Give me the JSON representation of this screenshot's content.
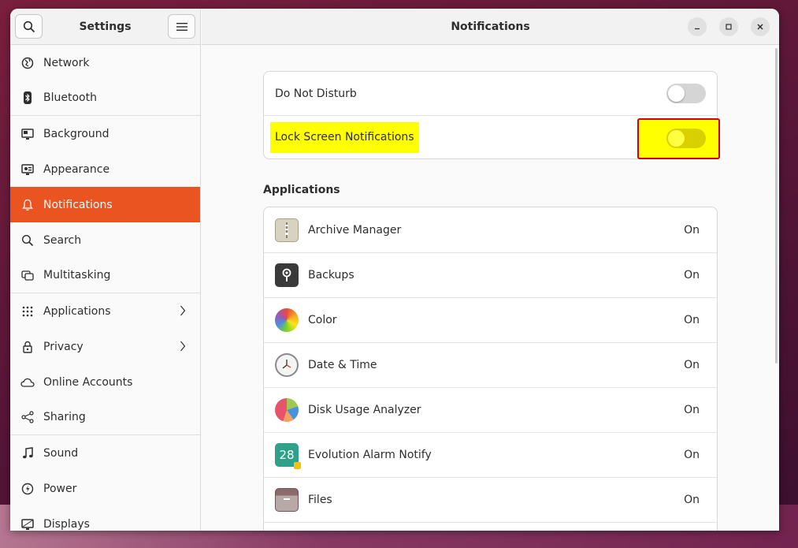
{
  "sidebar": {
    "title": "Settings",
    "items": [
      {
        "label": "Network",
        "icon": "network-icon"
      },
      {
        "label": "Bluetooth",
        "icon": "bluetooth-icon"
      },
      {
        "label": "Background",
        "icon": "background-icon"
      },
      {
        "label": "Appearance",
        "icon": "appearance-icon"
      },
      {
        "label": "Notifications",
        "icon": "bell-icon",
        "active": true
      },
      {
        "label": "Search",
        "icon": "search-icon"
      },
      {
        "label": "Multitasking",
        "icon": "multitasking-icon"
      },
      {
        "label": "Applications",
        "icon": "grid-icon",
        "has_chevron": true
      },
      {
        "label": "Privacy",
        "icon": "lock-icon",
        "has_chevron": true
      },
      {
        "label": "Online Accounts",
        "icon": "cloud-icon"
      },
      {
        "label": "Sharing",
        "icon": "share-icon"
      },
      {
        "label": "Sound",
        "icon": "music-note-icon"
      },
      {
        "label": "Power",
        "icon": "power-icon"
      },
      {
        "label": "Displays",
        "icon": "display-icon"
      }
    ]
  },
  "header": {
    "title": "Notifications"
  },
  "settings": {
    "dnd_label": "Do Not Disturb",
    "dnd_on": false,
    "lock_label": "Lock Screen Notifications",
    "lock_on": false
  },
  "applications": {
    "title": "Applications",
    "items": [
      {
        "name": "Archive Manager",
        "state": "On"
      },
      {
        "name": "Backups",
        "state": "On"
      },
      {
        "name": "Color",
        "state": "On"
      },
      {
        "name": "Date & Time",
        "state": "On"
      },
      {
        "name": "Disk Usage Analyzer",
        "state": "On"
      },
      {
        "name": "Evolution Alarm Notify",
        "state": "On",
        "icon_text": "28"
      },
      {
        "name": "Files",
        "state": "On"
      }
    ]
  },
  "colors": {
    "accent": "#e95420",
    "highlight": "#ffff00",
    "highlight_border": "#d40000"
  }
}
